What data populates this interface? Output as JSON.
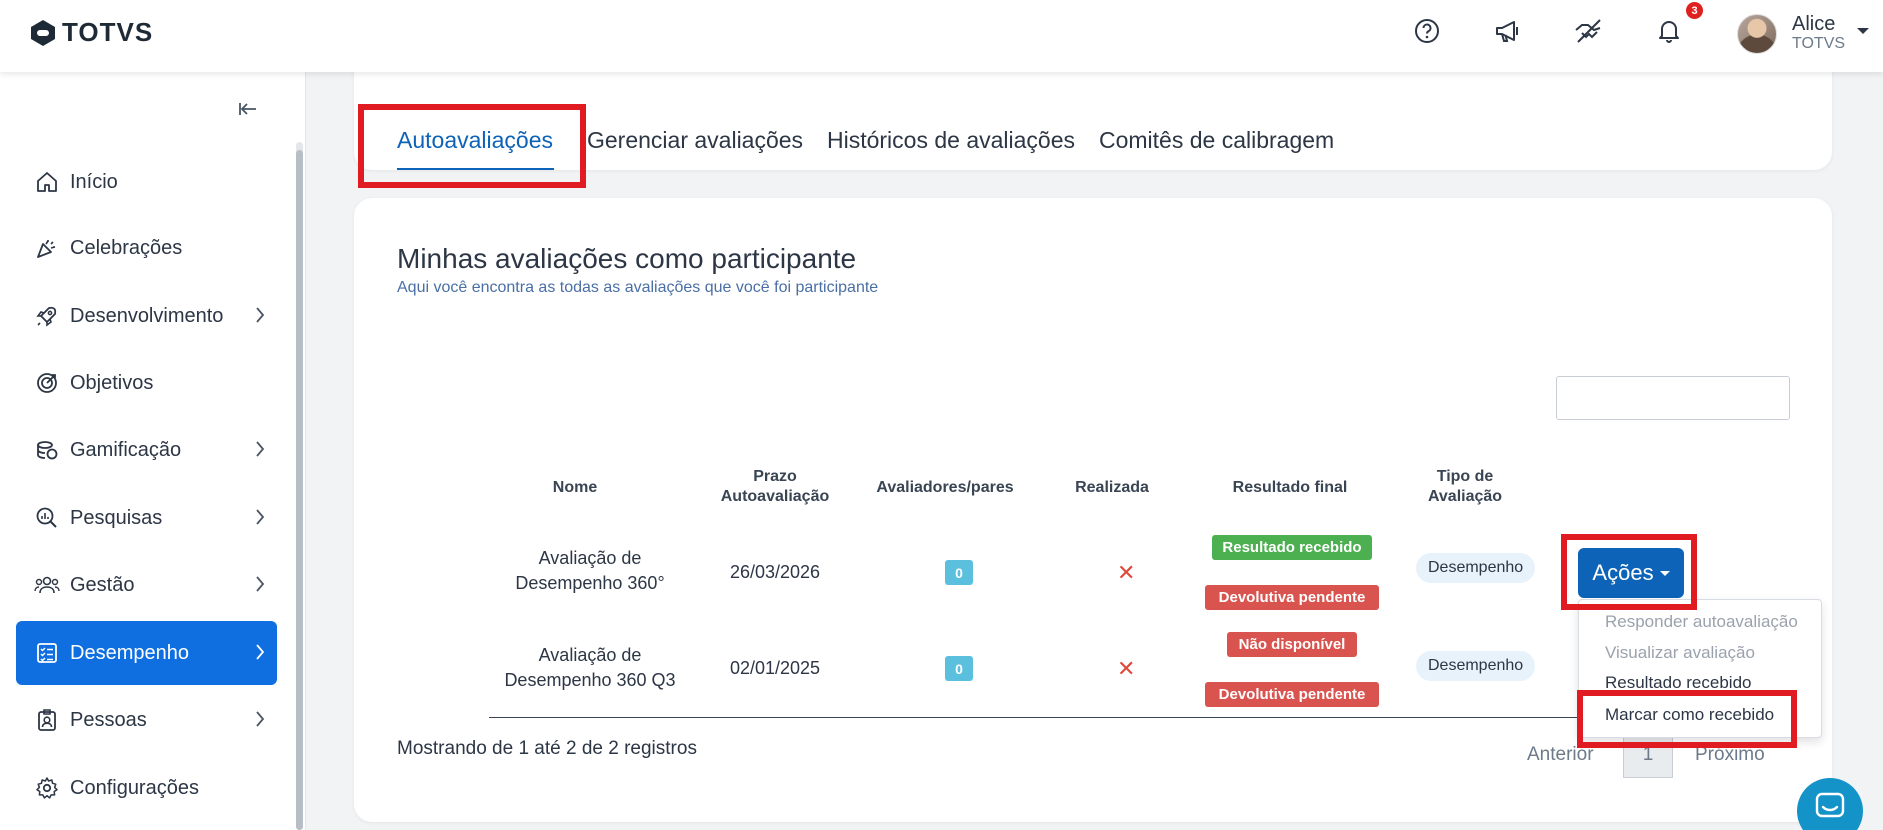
{
  "header": {
    "logo_text": "TOTVS",
    "notification_count": "3",
    "user_name": "Alice",
    "user_org": "TOTVS"
  },
  "sidebar": {
    "items": [
      {
        "label": "Início",
        "icon": "home-icon"
      },
      {
        "label": "Celebrações",
        "icon": "party-popper-icon"
      },
      {
        "label": "Desenvolvimento",
        "icon": "rocket-icon"
      },
      {
        "label": "Objetivos",
        "icon": "target-icon"
      },
      {
        "label": "Gamificação",
        "icon": "coins-icon"
      },
      {
        "label": "Pesquisas",
        "icon": "search-chart-icon"
      },
      {
        "label": "Gestão",
        "icon": "users-icon"
      },
      {
        "label": "Desempenho",
        "icon": "checklist-icon"
      },
      {
        "label": "Pessoas",
        "icon": "id-badge-icon"
      },
      {
        "label": "Configurações",
        "icon": "gear-icon"
      }
    ]
  },
  "tabs": [
    {
      "label": "Autoavaliações"
    },
    {
      "label": "Gerenciar avaliações"
    },
    {
      "label": "Históricos de avaliações"
    },
    {
      "label": "Comitês de calibragem"
    }
  ],
  "section": {
    "title": "Minhas avaliações como participante",
    "subtitle": "Aqui você encontra as todas as avaliações que você foi participante"
  },
  "table": {
    "headers": {
      "nome": "Nome",
      "prazo_1": "Prazo",
      "prazo_2": "Autoavaliação",
      "avaliadores": "Avaliadores/pares",
      "realizada": "Realizada",
      "resultado": "Resultado final",
      "tipo_1": "Tipo de",
      "tipo_2": "Avaliação"
    },
    "rows": [
      {
        "nome_1": "Avaliação de",
        "nome_2": "Desempenho 360°",
        "prazo": "26/03/2026",
        "avaliadores": "0",
        "realizada": "✕",
        "resultado_1": "Resultado recebido",
        "resultado_2": "Devolutiva pendente",
        "tipo": "Desempenho"
      },
      {
        "nome_1": "Avaliação de",
        "nome_2": "Desempenho 360 Q3",
        "prazo": "02/01/2025",
        "avaliadores": "0",
        "realizada": "✕",
        "resultado_1": "Não disponível",
        "resultado_2": "Devolutiva pendente",
        "tipo": "Desempenho"
      }
    ],
    "actions_label": "Ações"
  },
  "dropdown": {
    "items": [
      {
        "label": "Responder autoavaliação"
      },
      {
        "label": "Visualizar avaliação"
      },
      {
        "label": "Resultado recebido"
      },
      {
        "label": "Marcar como recebido"
      }
    ]
  },
  "pagination": {
    "showing": "Mostrando de 1 até 2 de 2 registros",
    "prev": "Anterior",
    "page": "1",
    "next": "Próximo"
  },
  "colors": {
    "primary": "#0c63b7",
    "active_nav": "#0f6fe0",
    "highlight": "#e01b22",
    "success": "#4caf50",
    "danger": "#d9534f",
    "info": "#5bc0de"
  }
}
